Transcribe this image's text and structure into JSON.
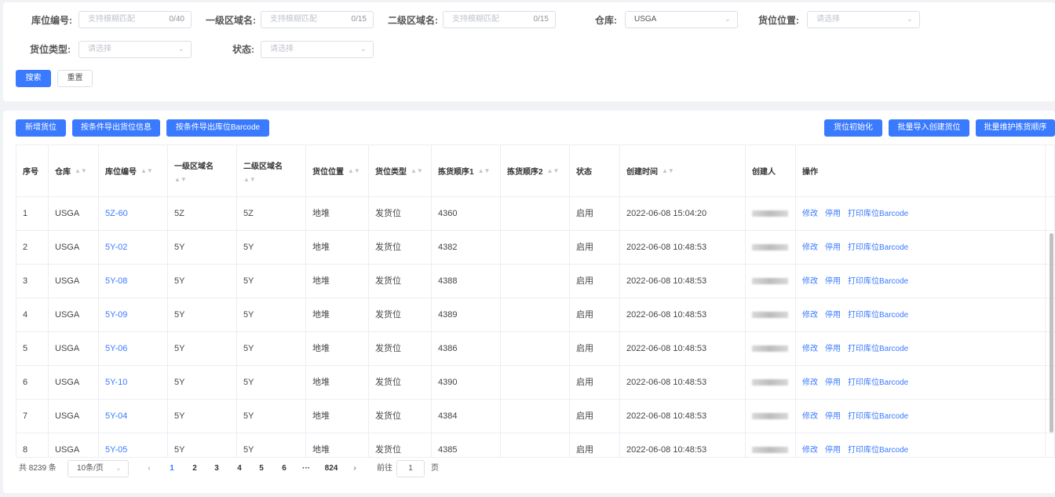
{
  "filters": {
    "location_code": {
      "label": "库位编号:",
      "placeholder": "支持模糊匹配",
      "count": "0/40"
    },
    "zone1": {
      "label": "一级区域名:",
      "placeholder": "支持模糊匹配",
      "count": "0/15"
    },
    "zone2": {
      "label": "二级区域名:",
      "placeholder": "支持模糊匹配",
      "count": "0/15"
    },
    "warehouse": {
      "label": "仓库:",
      "value": "USGA"
    },
    "position": {
      "label": "货位位置:",
      "placeholder": "请选择"
    },
    "type": {
      "label": "货位类型:",
      "placeholder": "请选择"
    },
    "status": {
      "label": "状态:",
      "placeholder": "请选择"
    },
    "search_btn": "搜索",
    "reset_btn": "重置"
  },
  "toolbar": {
    "add": "新增货位",
    "export_info": "按条件导出货位信息",
    "export_barcode": "按条件导出库位Barcode",
    "init": "货位初始化",
    "batch_import": "批量导入创建货位",
    "batch_order": "批量维护拣货顺序"
  },
  "table": {
    "headers": {
      "seq": "序号",
      "warehouse": "仓库",
      "code": "库位编号",
      "zone1": "一级区域名",
      "zone2": "二级区域名",
      "position": "货位位置",
      "type": "货位类型",
      "order1": "拣货顺序1",
      "order2": "拣货顺序2",
      "status": "状态",
      "created": "创建时间",
      "creator": "创建人",
      "ops": "操作"
    },
    "rows": [
      {
        "seq": "1",
        "warehouse": "USGA",
        "code": "5Z-60",
        "zone1": "5Z",
        "zone2": "5Z",
        "position": "地堆",
        "type": "发货位",
        "order1": "4360",
        "order2": "",
        "status": "启用",
        "created": "2022-06-08 15:04:20"
      },
      {
        "seq": "2",
        "warehouse": "USGA",
        "code": "5Y-02",
        "zone1": "5Y",
        "zone2": "5Y",
        "position": "地堆",
        "type": "发货位",
        "order1": "4382",
        "order2": "",
        "status": "启用",
        "created": "2022-06-08 10:48:53"
      },
      {
        "seq": "3",
        "warehouse": "USGA",
        "code": "5Y-08",
        "zone1": "5Y",
        "zone2": "5Y",
        "position": "地堆",
        "type": "发货位",
        "order1": "4388",
        "order2": "",
        "status": "启用",
        "created": "2022-06-08 10:48:53"
      },
      {
        "seq": "4",
        "warehouse": "USGA",
        "code": "5Y-09",
        "zone1": "5Y",
        "zone2": "5Y",
        "position": "地堆",
        "type": "发货位",
        "order1": "4389",
        "order2": "",
        "status": "启用",
        "created": "2022-06-08 10:48:53"
      },
      {
        "seq": "5",
        "warehouse": "USGA",
        "code": "5Y-06",
        "zone1": "5Y",
        "zone2": "5Y",
        "position": "地堆",
        "type": "发货位",
        "order1": "4386",
        "order2": "",
        "status": "启用",
        "created": "2022-06-08 10:48:53"
      },
      {
        "seq": "6",
        "warehouse": "USGA",
        "code": "5Y-10",
        "zone1": "5Y",
        "zone2": "5Y",
        "position": "地堆",
        "type": "发货位",
        "order1": "4390",
        "order2": "",
        "status": "启用",
        "created": "2022-06-08 10:48:53"
      },
      {
        "seq": "7",
        "warehouse": "USGA",
        "code": "5Y-04",
        "zone1": "5Y",
        "zone2": "5Y",
        "position": "地堆",
        "type": "发货位",
        "order1": "4384",
        "order2": "",
        "status": "启用",
        "created": "2022-06-08 10:48:53"
      },
      {
        "seq": "8",
        "warehouse": "USGA",
        "code": "5Y-05",
        "zone1": "5Y",
        "zone2": "5Y",
        "position": "地堆",
        "type": "发货位",
        "order1": "4385",
        "order2": "",
        "status": "启用",
        "created": "2022-06-08 10:48:53"
      }
    ],
    "actions": {
      "edit": "修改",
      "disable": "停用",
      "print": "打印库位Barcode"
    }
  },
  "pagination": {
    "total": "共 8239 条",
    "page_size": "10条/页",
    "pages": [
      "1",
      "2",
      "3",
      "4",
      "5",
      "6"
    ],
    "ellipsis": "···",
    "last": "824",
    "current": "1",
    "goto_prefix": "前往",
    "goto_value": "1",
    "goto_suffix": "页"
  },
  "colors": {
    "primary": "#3a7afe",
    "border": "#ebeef5",
    "background": "#f0f2f5"
  }
}
